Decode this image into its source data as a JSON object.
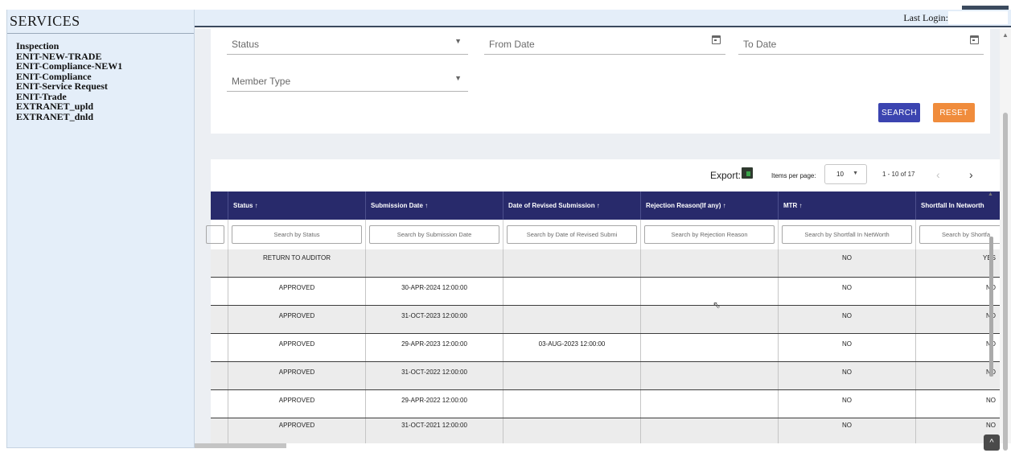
{
  "sidebar": {
    "title": "SERVICES",
    "items": [
      {
        "label": "Inspection"
      },
      {
        "label": "ENIT-NEW-TRADE"
      },
      {
        "label": "ENIT-Compliance-NEW1"
      },
      {
        "label": "ENIT-Compliance"
      },
      {
        "label": "ENIT-Service Request"
      },
      {
        "label": "ENIT-Trade"
      },
      {
        "label": "EXTRANET_upld"
      },
      {
        "label": "EXTRANET_dnld"
      }
    ]
  },
  "header": {
    "last_login_label": "Last Login:"
  },
  "filters": {
    "status": {
      "placeholder": "Status",
      "icon": "chevron-down-icon"
    },
    "from_date": {
      "placeholder": "From Date",
      "icon": "calendar-icon"
    },
    "to_date": {
      "placeholder": "To Date",
      "icon": "calendar-icon"
    },
    "member_type": {
      "placeholder": "Member Type",
      "icon": "chevron-down-icon"
    },
    "search_label": "SEARCH",
    "reset_label": "RESET"
  },
  "toolbar": {
    "export_label": "Export:",
    "items_per_page_label": "Items per page:",
    "items_per_page_value": "10",
    "range_label": "1 - 10 of 17",
    "prev": "‹",
    "next": "›"
  },
  "table": {
    "columns": [
      {
        "label": "",
        "search": ""
      },
      {
        "label": "Status ↑",
        "search": "Search by Status"
      },
      {
        "label": "Submission Date ↑",
        "search": "Search by Submission Date"
      },
      {
        "label": "Date of Revised Submission ↑",
        "search": "Search by Date of Revised Submi"
      },
      {
        "label": "Rejection Reason(If any) ↑",
        "search": "Search by Rejection Reason"
      },
      {
        "label": "MTR ↑",
        "search": "Search by Shortfall In NetWorth"
      },
      {
        "label": "Shortfall In Networth",
        "search": "Search by Shortfa"
      }
    ],
    "rows": [
      [
        "",
        "RETURN TO AUDITOR",
        "",
        "",
        "",
        "NO",
        "YES"
      ],
      [
        "",
        "APPROVED",
        "30-APR-2024 12:00:00",
        "",
        "",
        "NO",
        "NO"
      ],
      [
        "",
        "APPROVED",
        "31-OCT-2023 12:00:00",
        "",
        "",
        "NO",
        "NO"
      ],
      [
        "",
        "APPROVED",
        "29-APR-2023 12:00:00",
        "03-AUG-2023 12:00:00",
        "",
        "NO",
        "NO"
      ],
      [
        "",
        "APPROVED",
        "31-OCT-2022 12:00:00",
        "",
        "",
        "NO",
        "NO"
      ],
      [
        "",
        "APPROVED",
        "29-APR-2022 12:00:00",
        "",
        "",
        "NO",
        "NO"
      ],
      [
        "",
        "APPROVED",
        "31-OCT-2021 12:00:00",
        "",
        "",
        "NO",
        "NO"
      ]
    ]
  },
  "colors": {
    "header_bg": "#282a6b",
    "search_btn": "#3b44b0",
    "reset_btn": "#f08c3c",
    "sidebar_bg": "#e4eef9"
  }
}
